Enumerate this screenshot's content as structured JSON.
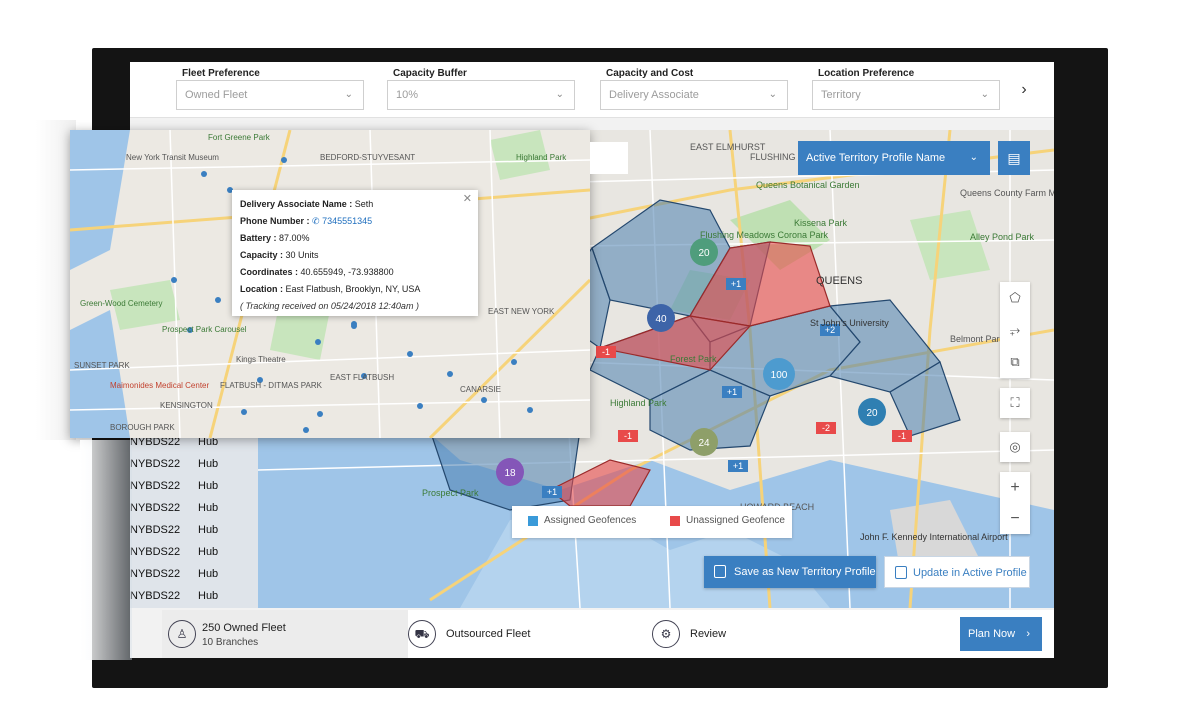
{
  "filters": [
    {
      "label": "Fleet Preference",
      "value": "Owned Fleet"
    },
    {
      "label": "Capacity Buffer",
      "value": "10%"
    },
    {
      "label": "Capacity and Cost",
      "value": "Delivery Associate"
    },
    {
      "label": "Location Preference",
      "value": "Territory"
    }
  ],
  "territory_dropdown": {
    "label": "Active Territory Profile Name"
  },
  "popup": {
    "name_label": "Delivery Associate Name :",
    "name_value": "Seth",
    "phone_label": "Phone Number :",
    "phone_value": "7345551345",
    "battery_label": "Battery :",
    "battery_value": "87.00%",
    "capacity_label": "Capacity :",
    "capacity_value": "30 Units",
    "coordinates_label": "Coordinates :",
    "coordinates_value": "40.655949, -73.938800",
    "location_label": "Location :",
    "location_value": "East Flatbush, Brooklyn, NY, USA",
    "tracking_note": "( Tracking received on 05/24/2018 12:40am )"
  },
  "clusters": [
    "20",
    "40",
    "100",
    "20",
    "24",
    "18"
  ],
  "badges": [
    "+1",
    "+2",
    "-1",
    "+1",
    "-2",
    "-1",
    "+1",
    "-1",
    "+1"
  ],
  "map_labels_left": [
    "Fort Greene Park",
    "New York Transit Museum",
    "BEDFORD-STUYVESANT",
    "Highland Park",
    "Green-Wood Cemetery",
    "Prospect Park Carousel",
    "Kings Theatre",
    "FLATBUSH - DITMAS PARK",
    "Maimonides Medical Center",
    "KENSINGTON",
    "BOROUGH PARK",
    "SUNSET PARK",
    "EAST NEW YORK",
    "EAST FLATBUSH",
    "CANARSIE"
  ],
  "map_labels_right": [
    "EAST ELMHURST",
    "FLUSHING",
    "Queens Botanical Garden",
    "Kissena Park",
    "Flushing Meadows Corona Park",
    "QUEENS",
    "Queens County Farm Museum",
    "Alley Pond Park",
    "St John's University",
    "Belmont Park",
    "Forest Park",
    "Highland Park",
    "Prospect Park",
    "John F. Kennedy International Airport",
    "HOWARD BEACH"
  ],
  "list_rows": [
    {
      "code": "NYBDS22",
      "type": "Hub"
    },
    {
      "code": "NYBDS22",
      "type": "Hub"
    },
    {
      "code": "NYBDS22",
      "type": "Hub"
    },
    {
      "code": "NYBDS22",
      "type": "Hub"
    },
    {
      "code": "NYBDS22",
      "type": "Hub"
    },
    {
      "code": "NYBDS22",
      "type": "Hub"
    },
    {
      "code": "NYBDS22",
      "type": "Hub"
    },
    {
      "code": "NYBDS22",
      "type": "Hub"
    }
  ],
  "legend": {
    "assigned": "Assigned Geofences",
    "unassigned": "Unassigned Geofence"
  },
  "buttons": {
    "save_new": "Save as New Territory Profile",
    "update_active": "Update in Active Profile",
    "plan_now": "Plan Now"
  },
  "steps": [
    {
      "title": "250 Owned Fleet",
      "sub": "10 Branches"
    },
    {
      "title": "Outsourced Fleet"
    },
    {
      "title": "Review"
    }
  ],
  "colors": {
    "accent": "#3a7fc1",
    "assigned": "#4a7fb0",
    "unassigned": "#e84a4a",
    "map_bg": "#e8e6e1"
  }
}
